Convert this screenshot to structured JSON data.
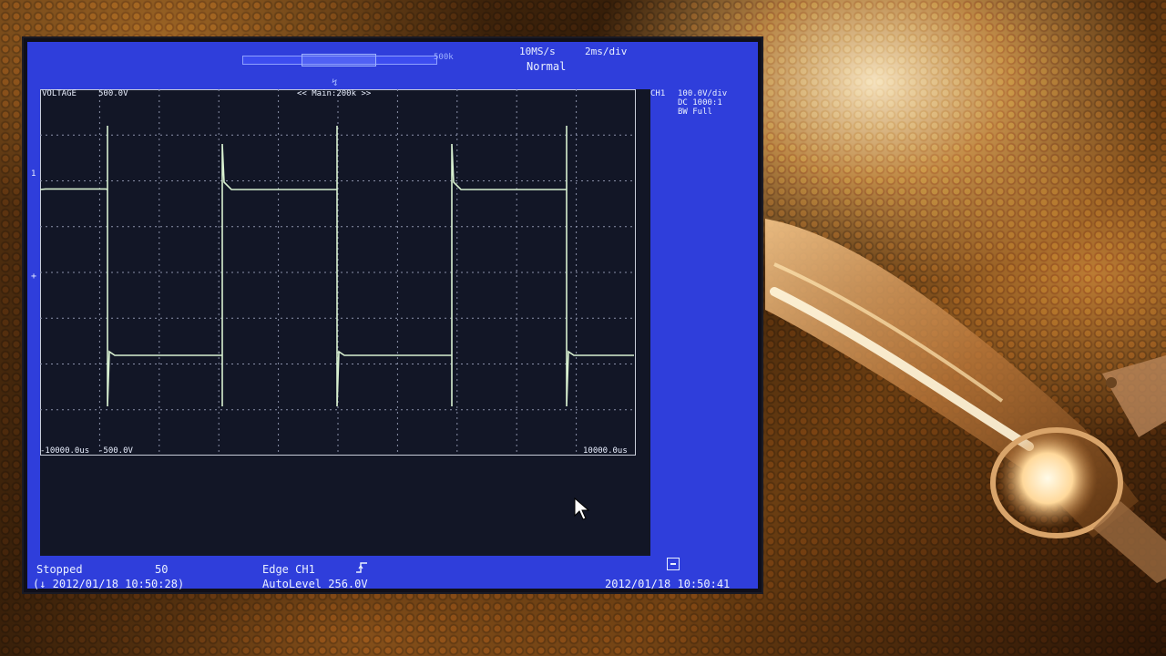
{
  "scope": {
    "header": {
      "sample_rate": "10MS/s",
      "time_div": "2ms/div",
      "trigger_mode": "Normal",
      "zoom_record": "500k",
      "trigger_marker": "↯"
    },
    "graticule": {
      "title": "VOLTAGE",
      "scale_top": "500.0V",
      "main_label": "<< Main:200k >>",
      "scale_bottom": "-500.0V",
      "time_left": "-10000.0us",
      "time_right": "10000.0us",
      "channel_marker": "1",
      "ground_marker": "+"
    },
    "channel": {
      "name": "CH1",
      "volts_div": "100.0V/div",
      "coupling": "DC  1000:1",
      "bandwidth": "BW Full"
    },
    "status": {
      "acq_state": "Stopped",
      "acq_count": "50",
      "acq_time": "(↓ 2012/01/18 10:50:28)",
      "trigger": "Edge CH1",
      "edge_icon": "rising-edge-icon",
      "trigger_level": "AutoLevel 256.0V",
      "clock": "2012/01/18 10:50:41"
    }
  },
  "colors": {
    "screen_bg": "#2f3edb",
    "trace": "#d8f0d0",
    "grid": "#8a90a8",
    "text": "#eaf0ff"
  }
}
